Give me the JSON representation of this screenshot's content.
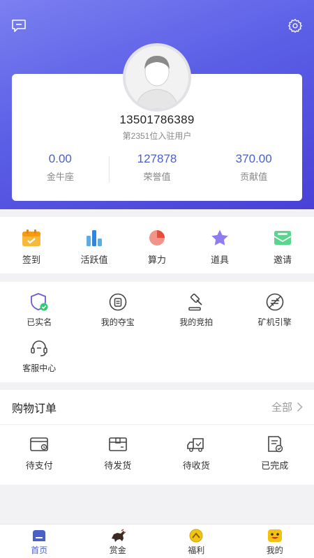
{
  "header": {
    "message_icon": "message-icon",
    "settings_icon": "gear-icon"
  },
  "profile": {
    "phone": "13501786389",
    "rank_text": "第2351位入驻用户",
    "stats": [
      {
        "value": "0.00",
        "label": "金牛座"
      },
      {
        "value": "127878",
        "label": "荣誉值"
      },
      {
        "value": "370.00",
        "label": "贡献值"
      }
    ]
  },
  "quick_actions": [
    {
      "label": "签到",
      "icon": "calendar-icon"
    },
    {
      "label": "活跃值",
      "icon": "bar-chart-icon"
    },
    {
      "label": "算力",
      "icon": "pie-chart-icon"
    },
    {
      "label": "道具",
      "icon": "star-icon"
    },
    {
      "label": "邀请",
      "icon": "envelope-icon"
    }
  ],
  "services": [
    {
      "label": "已实名",
      "icon": "verified-shield-icon"
    },
    {
      "label": "我的夺宝",
      "icon": "treasure-icon"
    },
    {
      "label": "我的竞拍",
      "icon": "gavel-icon"
    },
    {
      "label": "矿机引擎",
      "icon": "engine-icon"
    },
    {
      "label": "客服中心",
      "icon": "headset-icon"
    }
  ],
  "orders": {
    "title": "购物订单",
    "all_label": "全部",
    "items": [
      {
        "label": "待支付",
        "icon": "wallet-icon"
      },
      {
        "label": "待发货",
        "icon": "package-icon"
      },
      {
        "label": "待收货",
        "icon": "truck-icon"
      },
      {
        "label": "已完成",
        "icon": "completed-doc-icon"
      }
    ]
  },
  "tabs": [
    {
      "label": "首页",
      "icon": "home-icon",
      "active": true
    },
    {
      "label": "赏金",
      "icon": "bull-icon",
      "active": false
    },
    {
      "label": "福利",
      "icon": "gift-coin-icon",
      "active": false
    },
    {
      "label": "我的",
      "icon": "smiley-face-icon",
      "active": false
    }
  ],
  "colors": {
    "accent": "#4a5fc8",
    "header_gradient_start": "#7b7ff0",
    "header_gradient_end": "#4a40d6"
  }
}
